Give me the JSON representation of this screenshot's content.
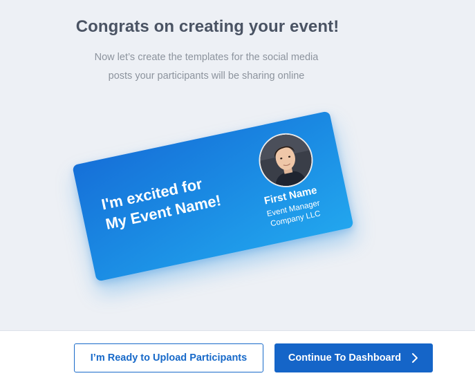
{
  "header": {
    "title": "Congrats on creating your event!",
    "subtitle_line1": "Now let’s create the templates for the social media",
    "subtitle_line2": "posts your participants will be sharing online"
  },
  "card": {
    "headline_line1": "I'm excited for",
    "headline_line2": "My Event Name!",
    "name": "First Name",
    "role": "Event Manager",
    "company": "Company LLC",
    "gradient_start": "#1670d8",
    "gradient_end": "#22a6ee"
  },
  "footer": {
    "upload_button_label": "I’m Ready to Upload Participants",
    "dashboard_button_label": "Continue To Dashboard",
    "dashboard_button_icon": "chevron-right-icon",
    "accent_color": "#1565c8"
  }
}
